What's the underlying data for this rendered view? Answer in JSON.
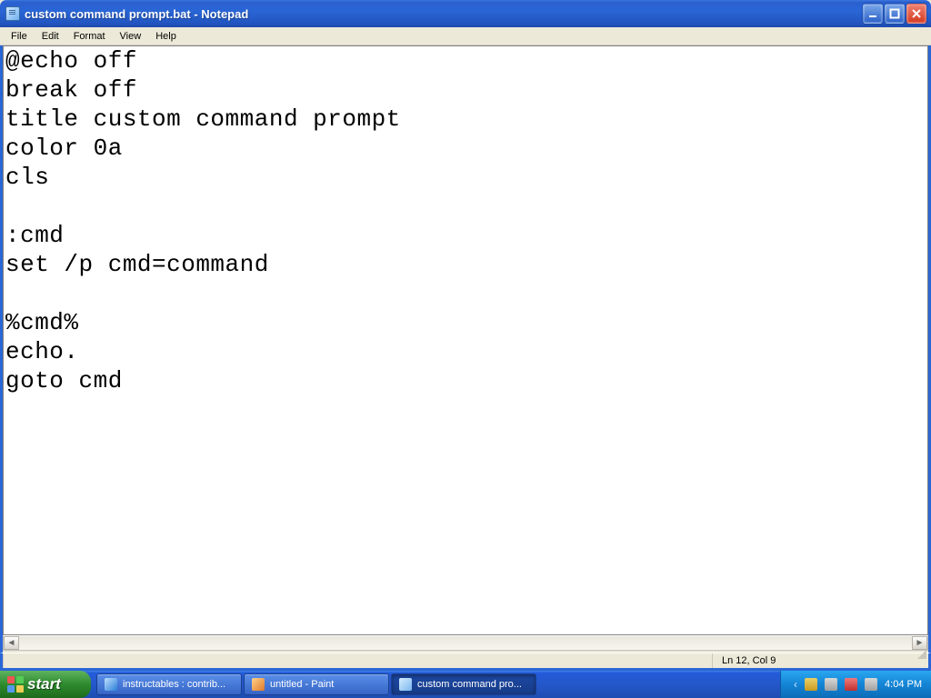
{
  "window": {
    "title": "custom command prompt.bat - Notepad"
  },
  "menu": {
    "items": [
      "File",
      "Edit",
      "Format",
      "View",
      "Help"
    ]
  },
  "editor": {
    "content": "@echo off\nbreak off\ntitle custom command prompt\ncolor 0a\ncls\n\n:cmd\nset /p cmd=command\n\n%cmd%\necho.\ngoto cmd"
  },
  "statusbar": {
    "position": "Ln 12, Col 9"
  },
  "taskbar": {
    "start_label": "start",
    "items": [
      {
        "label": "instructables : contrib...",
        "icon": "ie",
        "active": false
      },
      {
        "label": "untitled - Paint",
        "icon": "paint",
        "active": false
      },
      {
        "label": "custom command pro...",
        "icon": "note",
        "active": true
      }
    ],
    "clock": "4:04 PM"
  }
}
